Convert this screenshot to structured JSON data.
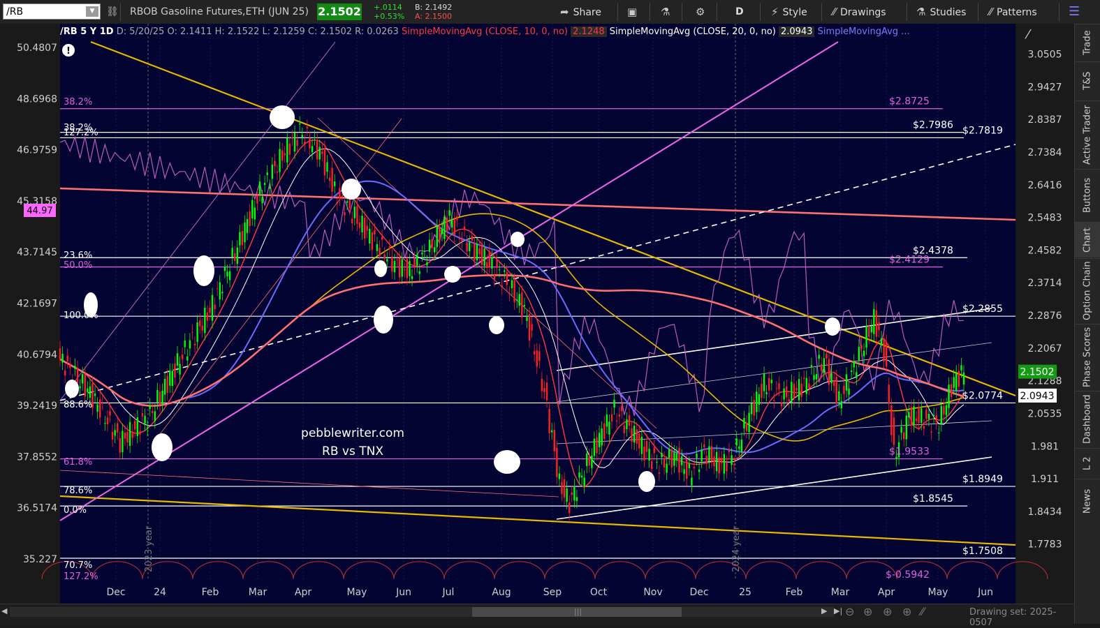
{
  "toolbar": {
    "symbol": "/RB",
    "instrument": "RBOB Gasoline Futures,ETH (JUN 25)",
    "last_price": "2.1502",
    "change": "+.0114",
    "change_pct": "+0.53%",
    "bid": "B: 2.1492",
    "ask": "A: 2.1500",
    "share_label": "Share",
    "period_label": "D",
    "style_label": "Style",
    "drawings_label": "Drawings",
    "studies_label": "Studies",
    "patterns_label": "Patterns",
    "icons": [
      "link-icon",
      "share-icon",
      "save-icon",
      "flask-icon",
      "gear-icon",
      "style-icon",
      "pencil-icon",
      "studies-icon",
      "patterns-icon",
      "menu-icon"
    ]
  },
  "header": {
    "period": "/RB 5 Y 1D",
    "date": "D: 5/20/25",
    "open": "O: 2.1411",
    "high": "H: 2.1522",
    "low": "L: 2.1259",
    "close": "C: 2.1502",
    "range": "R: 0.0263",
    "sma10_label": "SimpleMovingAvg (CLOSE, 10, 0, no)",
    "sma10_value": "2.1248",
    "sma20_label": "SimpleMovingAvg (CLOSE, 20, 0, no)",
    "sma20_value": "2.0943",
    "sma_more": "SimpleMovingAvg ...",
    "colors": {
      "sma10": "#ff3a3a",
      "sma20": "#ffffff",
      "sma_more": "#7b7bff"
    }
  },
  "watermark": {
    "line1": "pebblewriter.com",
    "line2": "RB vs TNX"
  },
  "right_panel": {
    "tabs": [
      "Trade",
      "T&S",
      "Active Trader",
      "Buttons",
      "Chart",
      "Option Chain",
      "Phase Scores",
      "Dashboard",
      "L 2",
      "News"
    ],
    "active": "Chart"
  },
  "bottom": {
    "drawing_set": "Drawing set: 2025-0507"
  },
  "chart_data": {
    "type": "candlestick",
    "x_ticks": [
      "Dec",
      "24",
      "Feb",
      "Mar",
      "Apr",
      "May",
      "Jun",
      "Jul",
      "Aug",
      "Sep",
      "Oct",
      "Nov",
      "Dec",
      "25",
      "Feb",
      "Mar",
      "Apr",
      "May",
      "Jun"
    ],
    "year_markers": [
      "2023 year",
      "2024 year"
    ],
    "right_axis": {
      "ticks": [
        "3.0505",
        "2.9427",
        "2.8387",
        "2.7384",
        "2.6416",
        "2.5483",
        "2.4582",
        "2.3714",
        "2.2876",
        "2.2067",
        "2.1288",
        "2.0535",
        "1.981",
        "1.911",
        "1.8434",
        "1.7783"
      ],
      "scale": "log",
      "range": [
        1.7508,
        3.0505
      ]
    },
    "left_axis": {
      "ticks": [
        "50.4807",
        "48.6968",
        "46.9759",
        "45.3158",
        "43.7145",
        "42.1697",
        "40.6794",
        "39.2419",
        "37.8552",
        "36.5174",
        "35.227"
      ],
      "badge": "44.97"
    },
    "price_badges": {
      "last": "2.1502",
      "sma20": "2.0943"
    },
    "levels_right": [
      {
        "label": "$2.8725",
        "value": 2.8725,
        "color": "#e060e0"
      },
      {
        "label": "$2.7986",
        "value": 2.7986,
        "color": "#ffffff"
      },
      {
        "label": "$2.7819",
        "value": 2.7819,
        "color": "#ffffff"
      },
      {
        "label": "$2.4378",
        "value": 2.4378,
        "color": "#ffffff"
      },
      {
        "label": "$2.4129",
        "value": 2.4129,
        "color": "#e060e0"
      },
      {
        "label": "$2.2855",
        "value": 2.2855,
        "color": "#ffffff"
      },
      {
        "label": "$2.0774",
        "value": 2.0774,
        "color": "#ffffff"
      },
      {
        "label": "$1.9533",
        "value": 1.9533,
        "color": "#e060e0"
      },
      {
        "label": "$1.8949",
        "value": 1.8949,
        "color": "#ffffff"
      },
      {
        "label": "$1.8545",
        "value": 1.8545,
        "color": "#ffffff"
      },
      {
        "label": "$1.7508",
        "value": 1.7508,
        "color": "#ffffff"
      },
      {
        "label": "$-0.5942",
        "value": null,
        "color": "#e060e0"
      }
    ],
    "fib_labels_left": [
      {
        "label": "38.2%",
        "color": "#e060e0"
      },
      {
        "label": "38.2%",
        "color": "#ffffff"
      },
      {
        "label": "127.2%",
        "color": "#ffffff"
      },
      {
        "label": "23.6%",
        "color": "#ffffff"
      },
      {
        "label": "50.0%",
        "color": "#e060e0"
      },
      {
        "label": "100.0%",
        "color": "#ffffff"
      },
      {
        "label": "88.6%",
        "color": "#ffffff"
      },
      {
        "label": "61.8%",
        "color": "#e060e0"
      },
      {
        "label": "78.6%",
        "color": "#ffffff"
      },
      {
        "label": "0.0%",
        "color": "#ffffff"
      },
      {
        "label": "70.7%",
        "color": "#ffffff"
      },
      {
        "label": "127.2%",
        "color": "#e060e0"
      }
    ],
    "close_path": [
      [
        0,
        2.18
      ],
      [
        12,
        2.1
      ],
      [
        24,
        1.99
      ],
      [
        36,
        2.05
      ],
      [
        48,
        2.18
      ],
      [
        60,
        2.3
      ],
      [
        70,
        2.45
      ],
      [
        80,
        2.62
      ],
      [
        90,
        2.74
      ],
      [
        96,
        2.8
      ],
      [
        104,
        2.74
      ],
      [
        110,
        2.62
      ],
      [
        118,
        2.55
      ],
      [
        126,
        2.48
      ],
      [
        134,
        2.42
      ],
      [
        140,
        2.4
      ],
      [
        148,
        2.46
      ],
      [
        156,
        2.55
      ],
      [
        160,
        2.5
      ],
      [
        166,
        2.46
      ],
      [
        172,
        2.42
      ],
      [
        178,
        2.38
      ],
      [
        186,
        2.3
      ],
      [
        194,
        2.1
      ],
      [
        200,
        1.9
      ],
      [
        204,
        1.86
      ],
      [
        210,
        1.93
      ],
      [
        216,
        2.0
      ],
      [
        222,
        2.06
      ],
      [
        228,
        2.02
      ],
      [
        234,
        1.97
      ],
      [
        240,
        1.94
      ],
      [
        246,
        1.96
      ],
      [
        252,
        1.92
      ],
      [
        258,
        1.97
      ],
      [
        264,
        1.94
      ],
      [
        270,
        1.96
      ],
      [
        276,
        2.05
      ],
      [
        282,
        2.12
      ],
      [
        290,
        2.09
      ],
      [
        298,
        2.12
      ],
      [
        306,
        2.18
      ],
      [
        312,
        2.08
      ],
      [
        318,
        2.16
      ],
      [
        326,
        2.28
      ],
      [
        330,
        2.2
      ],
      [
        334,
        1.96
      ],
      [
        340,
        2.05
      ],
      [
        346,
        2.04
      ],
      [
        352,
        2.03
      ],
      [
        358,
        2.13
      ],
      [
        362,
        2.15
      ]
    ],
    "colors": {
      "background": "#040432",
      "up": "#00ff00",
      "down": "#ff2020",
      "sma_blue": "#6b6bff",
      "sma_yellow": "#e6b800",
      "sma_salmon": "#ff7070",
      "overlay": "#cc66cc"
    }
  }
}
